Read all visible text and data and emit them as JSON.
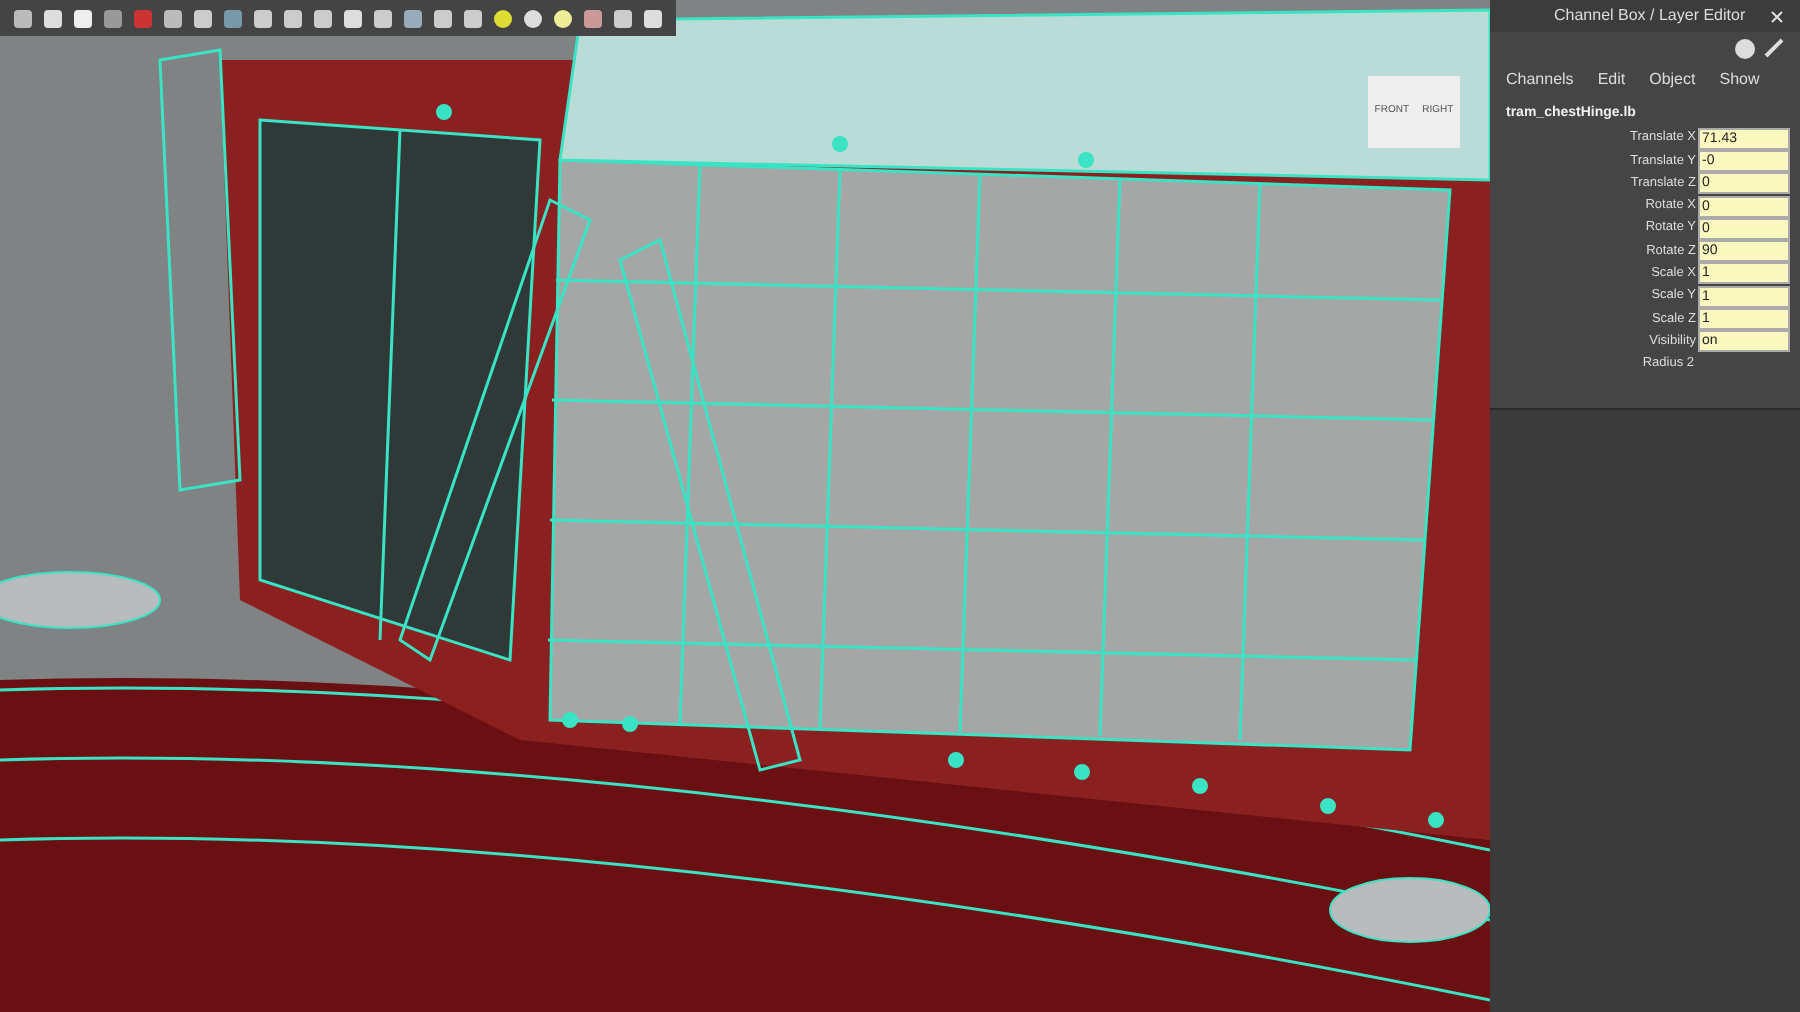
{
  "view_cube": {
    "front": "FRONT",
    "right": "RIGHT"
  },
  "channel_box": {
    "title": "Channel Box / Layer Editor",
    "menu": [
      "Channels",
      "Edit",
      "Object",
      "Show"
    ],
    "object_name": "tram_chestHinge.lb",
    "channels": [
      {
        "kind": "field",
        "label": "Translate X",
        "value": "71.43"
      },
      {
        "kind": "field",
        "label": "Translate Y",
        "value": "-0"
      },
      {
        "kind": "field",
        "label": "Translate Z",
        "value": "0"
      },
      {
        "kind": "field",
        "label": "Rotate X",
        "value": "0"
      },
      {
        "kind": "field",
        "label": "Rotate Y",
        "value": "0"
      },
      {
        "kind": "field",
        "label": "Rotate Z",
        "value": "90"
      },
      {
        "kind": "field",
        "label": "Scale X",
        "value": "1"
      },
      {
        "kind": "field",
        "label": "Scale Y",
        "value": "1"
      },
      {
        "kind": "field",
        "label": "Scale Z",
        "value": "1"
      },
      {
        "kind": "field",
        "label": "Visibility",
        "value": "on"
      },
      {
        "kind": "plain",
        "label": "Radius 2"
      }
    ]
  }
}
